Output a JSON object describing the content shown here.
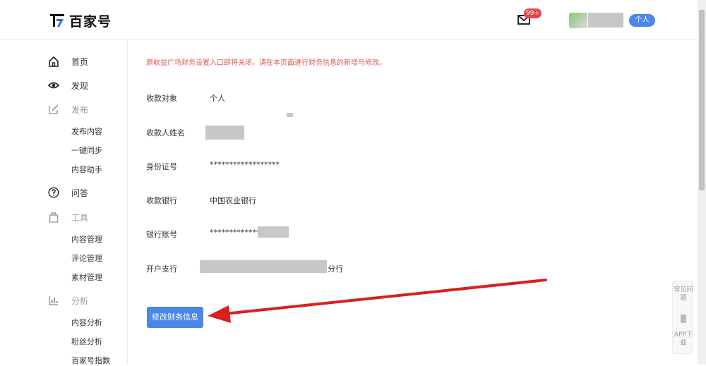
{
  "header": {
    "logo_text": "百家号",
    "mail_badge": "99+",
    "role_badge": "个人"
  },
  "sidebar": {
    "home": "首页",
    "discover": "发现",
    "publish": "发布",
    "publish_items": [
      "发布内容",
      "一键同步",
      "内容助手"
    ],
    "qa": "问答",
    "tools": "工具",
    "tools_items": [
      "内容管理",
      "评论管理",
      "素材管理"
    ],
    "analysis": "分析",
    "analysis_items": [
      "内容分析",
      "粉丝分析",
      "百家号指数"
    ]
  },
  "content": {
    "notice": "原收益广场财务设置入口即将关闭，请在本页面进行财务信息的新增与修改。",
    "fields": [
      {
        "label": "收款对象",
        "value": "个人"
      },
      {
        "label": "收款人姓名",
        "value": ""
      },
      {
        "label": "身份证号",
        "value": "******************"
      },
      {
        "label": "收款银行",
        "value": "中国农业银行"
      },
      {
        "label": "银行账号",
        "value": "**************"
      },
      {
        "label": "开户支行",
        "value": "分行"
      }
    ],
    "submit_label": "修改财务信息"
  },
  "float_tools": {
    "faq": "常见问题",
    "app": "APP下载"
  },
  "colors": {
    "accent": "#4a87e8",
    "notice": "#e05b4a",
    "arrow": "#d9201f"
  }
}
